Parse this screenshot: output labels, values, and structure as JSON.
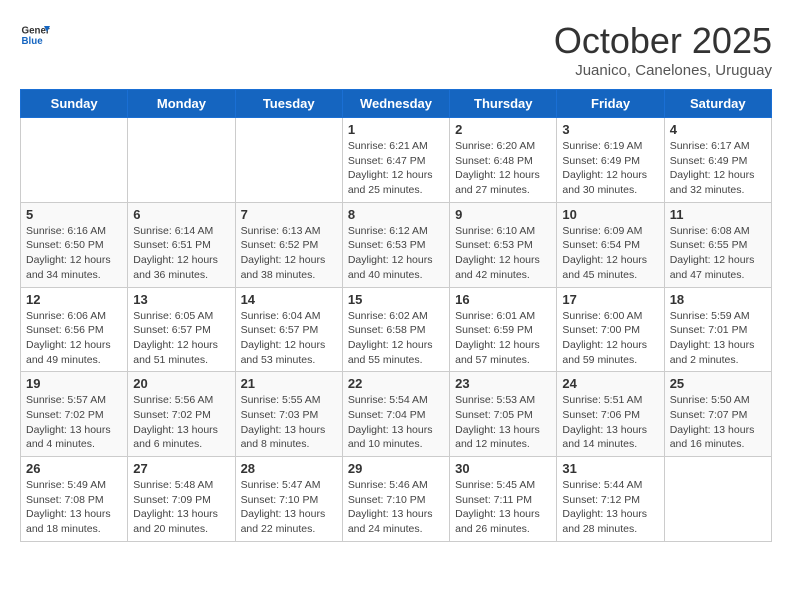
{
  "header": {
    "logo_general": "General",
    "logo_blue": "Blue",
    "month": "October 2025",
    "location": "Juanico, Canelones, Uruguay"
  },
  "days_of_week": [
    "Sunday",
    "Monday",
    "Tuesday",
    "Wednesday",
    "Thursday",
    "Friday",
    "Saturday"
  ],
  "weeks": [
    [
      {
        "day": "",
        "info": ""
      },
      {
        "day": "",
        "info": ""
      },
      {
        "day": "",
        "info": ""
      },
      {
        "day": "1",
        "info": "Sunrise: 6:21 AM\nSunset: 6:47 PM\nDaylight: 12 hours\nand 25 minutes."
      },
      {
        "day": "2",
        "info": "Sunrise: 6:20 AM\nSunset: 6:48 PM\nDaylight: 12 hours\nand 27 minutes."
      },
      {
        "day": "3",
        "info": "Sunrise: 6:19 AM\nSunset: 6:49 PM\nDaylight: 12 hours\nand 30 minutes."
      },
      {
        "day": "4",
        "info": "Sunrise: 6:17 AM\nSunset: 6:49 PM\nDaylight: 12 hours\nand 32 minutes."
      }
    ],
    [
      {
        "day": "5",
        "info": "Sunrise: 6:16 AM\nSunset: 6:50 PM\nDaylight: 12 hours\nand 34 minutes."
      },
      {
        "day": "6",
        "info": "Sunrise: 6:14 AM\nSunset: 6:51 PM\nDaylight: 12 hours\nand 36 minutes."
      },
      {
        "day": "7",
        "info": "Sunrise: 6:13 AM\nSunset: 6:52 PM\nDaylight: 12 hours\nand 38 minutes."
      },
      {
        "day": "8",
        "info": "Sunrise: 6:12 AM\nSunset: 6:53 PM\nDaylight: 12 hours\nand 40 minutes."
      },
      {
        "day": "9",
        "info": "Sunrise: 6:10 AM\nSunset: 6:53 PM\nDaylight: 12 hours\nand 42 minutes."
      },
      {
        "day": "10",
        "info": "Sunrise: 6:09 AM\nSunset: 6:54 PM\nDaylight: 12 hours\nand 45 minutes."
      },
      {
        "day": "11",
        "info": "Sunrise: 6:08 AM\nSunset: 6:55 PM\nDaylight: 12 hours\nand 47 minutes."
      }
    ],
    [
      {
        "day": "12",
        "info": "Sunrise: 6:06 AM\nSunset: 6:56 PM\nDaylight: 12 hours\nand 49 minutes."
      },
      {
        "day": "13",
        "info": "Sunrise: 6:05 AM\nSunset: 6:57 PM\nDaylight: 12 hours\nand 51 minutes."
      },
      {
        "day": "14",
        "info": "Sunrise: 6:04 AM\nSunset: 6:57 PM\nDaylight: 12 hours\nand 53 minutes."
      },
      {
        "day": "15",
        "info": "Sunrise: 6:02 AM\nSunset: 6:58 PM\nDaylight: 12 hours\nand 55 minutes."
      },
      {
        "day": "16",
        "info": "Sunrise: 6:01 AM\nSunset: 6:59 PM\nDaylight: 12 hours\nand 57 minutes."
      },
      {
        "day": "17",
        "info": "Sunrise: 6:00 AM\nSunset: 7:00 PM\nDaylight: 12 hours\nand 59 minutes."
      },
      {
        "day": "18",
        "info": "Sunrise: 5:59 AM\nSunset: 7:01 PM\nDaylight: 13 hours\nand 2 minutes."
      }
    ],
    [
      {
        "day": "19",
        "info": "Sunrise: 5:57 AM\nSunset: 7:02 PM\nDaylight: 13 hours\nand 4 minutes."
      },
      {
        "day": "20",
        "info": "Sunrise: 5:56 AM\nSunset: 7:02 PM\nDaylight: 13 hours\nand 6 minutes."
      },
      {
        "day": "21",
        "info": "Sunrise: 5:55 AM\nSunset: 7:03 PM\nDaylight: 13 hours\nand 8 minutes."
      },
      {
        "day": "22",
        "info": "Sunrise: 5:54 AM\nSunset: 7:04 PM\nDaylight: 13 hours\nand 10 minutes."
      },
      {
        "day": "23",
        "info": "Sunrise: 5:53 AM\nSunset: 7:05 PM\nDaylight: 13 hours\nand 12 minutes."
      },
      {
        "day": "24",
        "info": "Sunrise: 5:51 AM\nSunset: 7:06 PM\nDaylight: 13 hours\nand 14 minutes."
      },
      {
        "day": "25",
        "info": "Sunrise: 5:50 AM\nSunset: 7:07 PM\nDaylight: 13 hours\nand 16 minutes."
      }
    ],
    [
      {
        "day": "26",
        "info": "Sunrise: 5:49 AM\nSunset: 7:08 PM\nDaylight: 13 hours\nand 18 minutes."
      },
      {
        "day": "27",
        "info": "Sunrise: 5:48 AM\nSunset: 7:09 PM\nDaylight: 13 hours\nand 20 minutes."
      },
      {
        "day": "28",
        "info": "Sunrise: 5:47 AM\nSunset: 7:10 PM\nDaylight: 13 hours\nand 22 minutes."
      },
      {
        "day": "29",
        "info": "Sunrise: 5:46 AM\nSunset: 7:10 PM\nDaylight: 13 hours\nand 24 minutes."
      },
      {
        "day": "30",
        "info": "Sunrise: 5:45 AM\nSunset: 7:11 PM\nDaylight: 13 hours\nand 26 minutes."
      },
      {
        "day": "31",
        "info": "Sunrise: 5:44 AM\nSunset: 7:12 PM\nDaylight: 13 hours\nand 28 minutes."
      },
      {
        "day": "",
        "info": ""
      }
    ]
  ]
}
